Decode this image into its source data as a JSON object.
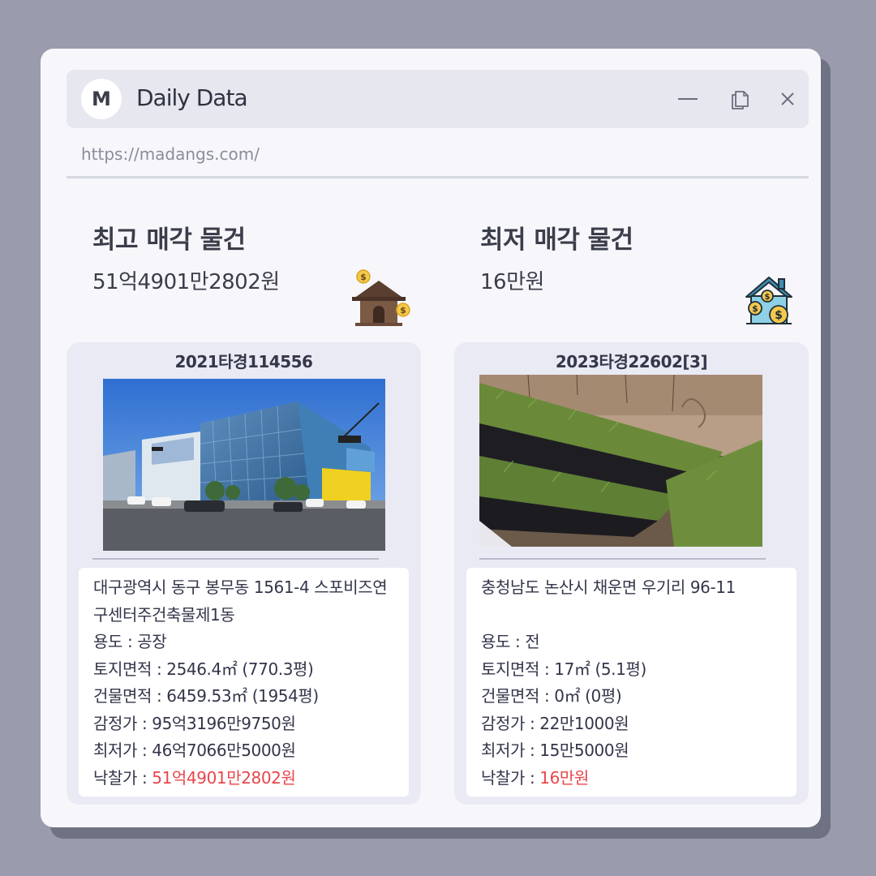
{
  "app": {
    "logo_letter": "M",
    "title": "Daily Data",
    "url": "https://madangs.com/"
  },
  "window_controls": [
    "minimize-icon",
    "restore-icon",
    "close-icon"
  ],
  "highest": {
    "heading": "최고 매각 물건",
    "price": "51억4901만2802원",
    "icon": "house-money-icon",
    "case_no": "2021타경114556",
    "address": "대구광역시 동구 봉무동 1561-4 스포비즈연구센터주건축물제1동",
    "usage": "용도 : 공장",
    "land_area": "토지면적 : 2546.4㎡ (770.3평)",
    "building_area": "건물면적 : 6459.53㎡ (1954평)",
    "appraisal": "감정가 : 95억3196만9750원",
    "minimum": "최저가 : 46억7066만5000원",
    "winning_label": "낙찰가 : ",
    "winning_value": "51억4901만2802원"
  },
  "lowest": {
    "heading": "최저 매각 물건",
    "price": "16만원",
    "icon": "house-coins-icon",
    "case_no": "2023타경22602[3]",
    "address": "충청남도 논산시 채운면 우기리 96-11",
    "usage": "용도 : 전",
    "land_area": "토지면적 : 17㎡ (5.1평)",
    "building_area": "건물면적 : 0㎡ (0평)",
    "appraisal": "감정가 : 22만1000원",
    "minimum": "최저가 : 15만5000원",
    "winning_label": "낙찰가 : ",
    "winning_value": "16만원"
  },
  "colors": {
    "background": "#9a9cad",
    "window": "#f7f7fb",
    "card": "#e9eaf4",
    "price_highlight": "#e8464a"
  }
}
